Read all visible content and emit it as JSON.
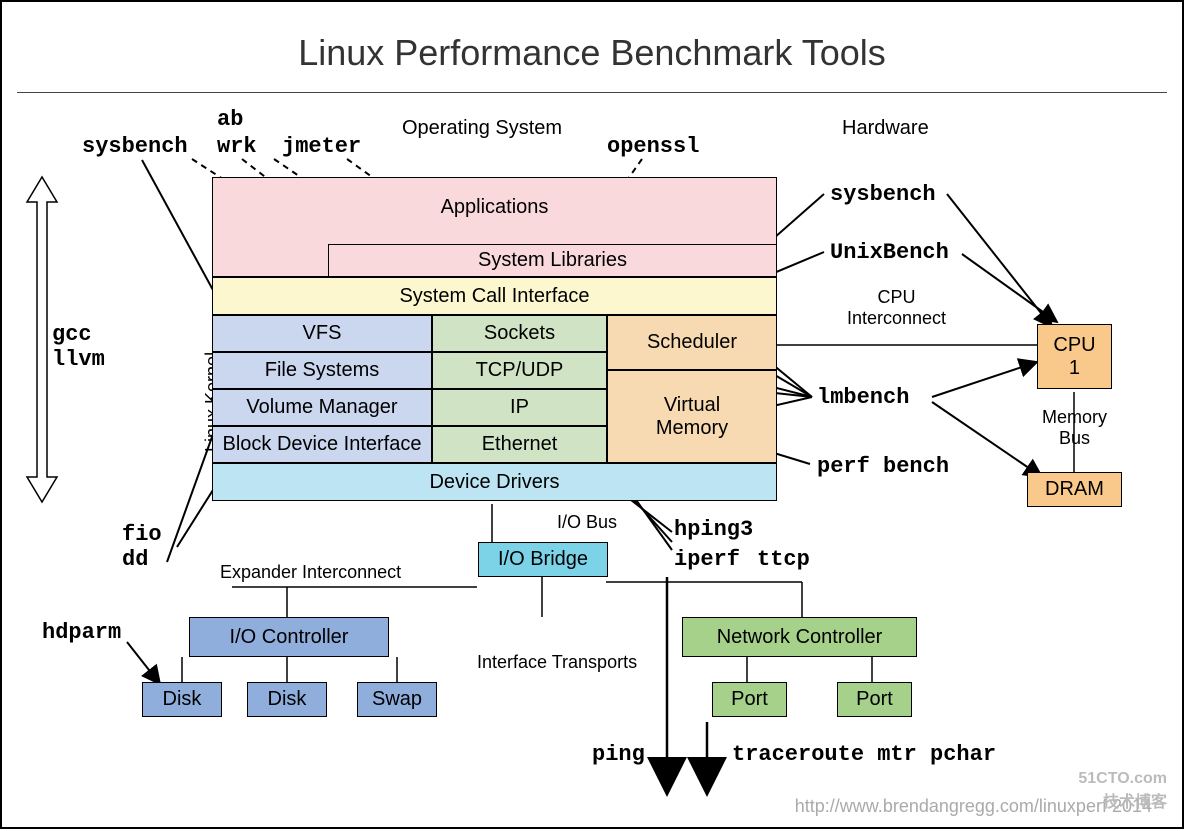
{
  "title": "Linux Performance Benchmark Tools",
  "sections": {
    "os": "Operating System",
    "hw": "Hardware",
    "kernel": "Linux Kernel"
  },
  "tools": {
    "sysbench": "sysbench",
    "ab": "ab",
    "wrk": "wrk",
    "jmeter": "jmeter",
    "openssl": "openssl",
    "sysbench2": "sysbench",
    "unixbench": "UnixBench",
    "lmbench": "lmbench",
    "perfbench": "perf bench",
    "gcc": "gcc",
    "llvm": "llvm",
    "fio": "fio",
    "dd": "dd",
    "hdparm": "hdparm",
    "hping3": "hping3",
    "iperf": "iperf",
    "ttcp": "ttcp",
    "ping": "ping",
    "traceroute": "traceroute mtr pchar"
  },
  "boxes": {
    "apps": "Applications",
    "syslib": "System Libraries",
    "sci": "System Call Interface",
    "vfs": "VFS",
    "fs": "File Systems",
    "vm": "Volume Manager",
    "bdi": "Block Device Interface",
    "sockets": "Sockets",
    "tcp": "TCP/UDP",
    "ip": "IP",
    "eth": "Ethernet",
    "sched": "Scheduler",
    "vmem": "Virtual\nMemory",
    "dd": "Device Drivers",
    "iob": "I/O Bridge",
    "ioc": "I/O Controller",
    "nc": "Network Controller",
    "disk": "Disk",
    "swap": "Swap",
    "port": "Port",
    "cpu": "CPU\n1",
    "dram": "DRAM"
  },
  "labels": {
    "iobus": "I/O Bus",
    "exp": "Expander Interconnect",
    "it": "Interface Transports",
    "cpui": "CPU\nInterconnect",
    "mbus": "Memory\nBus"
  },
  "footer": "http://www.brendangregg.com/linuxperf     2014",
  "watermark": "51CTO.com\n技术博客"
}
